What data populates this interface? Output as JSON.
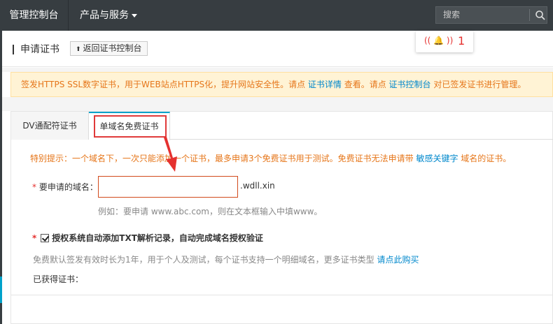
{
  "topbar": {
    "brand": "管理控制台",
    "menu": "产品与服务",
    "search_placeholder": "搜索"
  },
  "page": {
    "title": "申请证书",
    "back_button": "返回证书控制台"
  },
  "notification": {
    "count": "1"
  },
  "banner": {
    "text1": "签发HTTPS SSL数字证书，用于WEB站点HTTPS化，提升网站安全性。请点 ",
    "link1": "证书详情",
    "text2": " 查看。请点 ",
    "link2": "证书控制台",
    "text3": " 对已签发证书进行管理。"
  },
  "tabs": [
    {
      "label": "DV通配符证书"
    },
    {
      "label": "单域名免费证书"
    }
  ],
  "form": {
    "hint_text": "特别提示：一个域名下，一次只能添加一个证书，最多申请3个免费证书用于测试。免费证书无法申请带 ",
    "hint_link": "敏感关键字",
    "hint_tail": " 域名的证书。",
    "domain_label": "要申请的域名：",
    "domain_value": "",
    "domain_suffix": ".wdll.xin",
    "example": "例如：要申请 www.abc.com，则在文本框输入中填www。",
    "auth_label": "授权系统自动添加TXT解析记录，自动完成域名授权验证",
    "auth_checked": true,
    "validity_text": "免费默认签发有效时长为1年，用于个人及测试，每个证书支持一个明细域名，更多证书类型 ",
    "validity_link": "请点此购买",
    "obtained_label": "已获得证书："
  },
  "colors": {
    "accent": "#00a2ca",
    "warning_text": "#e6761a",
    "link": "#0088cc",
    "highlight_box": "#e03a3a"
  }
}
